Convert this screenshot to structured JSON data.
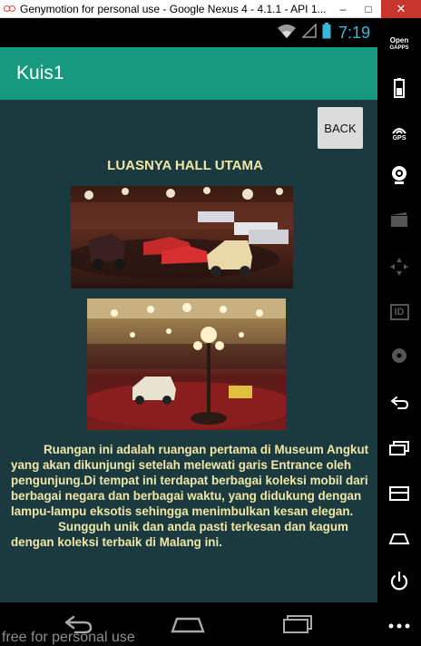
{
  "window": {
    "title": "Genymotion for personal use - Google Nexus 4 - 4.1.1 - API 1...",
    "minimize": "–",
    "maximize": "□",
    "close": "✕"
  },
  "status_bar": {
    "time": "7:19"
  },
  "action_bar": {
    "title": "Kuis1"
  },
  "content": {
    "back_label": "BACK",
    "heading": "LUASNYA HALL UTAMA",
    "images": [
      {
        "icon": "museum-car-hall-photo-1"
      },
      {
        "icon": "museum-car-hall-photo-2"
      }
    ],
    "description_1": "Ruangan ini adalah ruangan pertama di Museum Angkut yang akan dikunjungi setelah melewati garis Entrance oleh pengunjung.Di tempat ini terdapat berbagai koleksi mobil dari berbagai negara dan berbagai waktu, yang didukung dengan lampu-lampu eksotis sehingga menimbulkan kesan elegan.",
    "description_2": "Sungguh unik dan anda pasti terkesan dan kagum dengan koleksi terbaik di Malang ini."
  },
  "watermark": "free for personal use",
  "sidebar": {
    "opengapps_label": "Open\nGAPPS",
    "gps_label": "GPS",
    "id_label": "ID"
  },
  "colors": {
    "action_bar": "#17997f",
    "content_bg": "#1b3a40",
    "text": "#f0e6a6",
    "clock": "#38b8d8",
    "close_button": "#c7352c"
  }
}
